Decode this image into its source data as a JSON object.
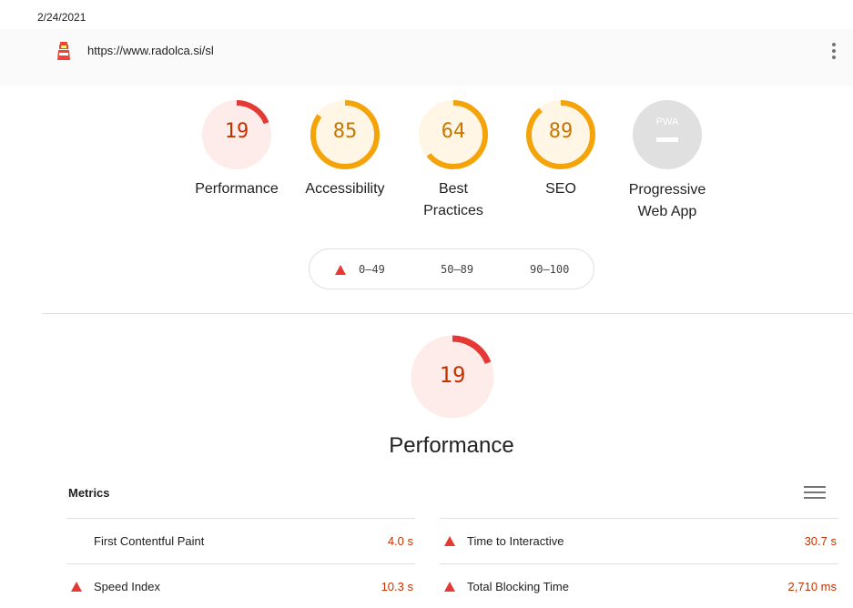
{
  "header": {
    "date": "2/24/2021",
    "url": "https://www.radolca.si/sl",
    "logo_icon": "lighthouse-icon",
    "menu_icon": "kebab-menu-icon"
  },
  "gauges": [
    {
      "score": "19",
      "label": "Performance",
      "score_fraction": 0.19,
      "status": "fail"
    },
    {
      "score": "85",
      "label": "Accessibility",
      "score_fraction": 0.85,
      "status": "average"
    },
    {
      "score": "64",
      "label_line1": "Best",
      "label_line2": "Practices",
      "score_fraction": 0.64,
      "status": "average"
    },
    {
      "score": "89",
      "label": "SEO",
      "score_fraction": 0.89,
      "status": "average"
    },
    {
      "badge": "PWA",
      "label_line1": "Progressive",
      "label_line2": "Web App",
      "status": "na"
    }
  ],
  "legend": {
    "fail": "0–49",
    "average": "50–89",
    "pass": "90–100"
  },
  "performance": {
    "score": "19",
    "score_fraction": 0.19,
    "title": "Performance"
  },
  "metrics": {
    "heading": "Metrics",
    "toggle_icon": "view-toggle-icon",
    "items": [
      {
        "name": "First Contentful Paint",
        "value": "4.0 s",
        "status": "fail",
        "icon": "none"
      },
      {
        "name": "Time to Interactive",
        "value": "30.7 s",
        "status": "fail",
        "icon": "fail-triangle-icon"
      },
      {
        "name": "Speed Index",
        "value": "10.3 s",
        "status": "fail",
        "icon": "fail-triangle-icon"
      },
      {
        "name": "Total Blocking Time",
        "value": "2,710 ms",
        "status": "fail",
        "icon": "fail-triangle-icon"
      }
    ]
  },
  "colors": {
    "fail": "#e53935",
    "fail_text": "#c33300",
    "fail_bg": "#fdecea",
    "average": "#f4a308",
    "average_text": "#c77700",
    "average_bg": "#fff6e5",
    "na_bg": "#e0e0e0"
  }
}
